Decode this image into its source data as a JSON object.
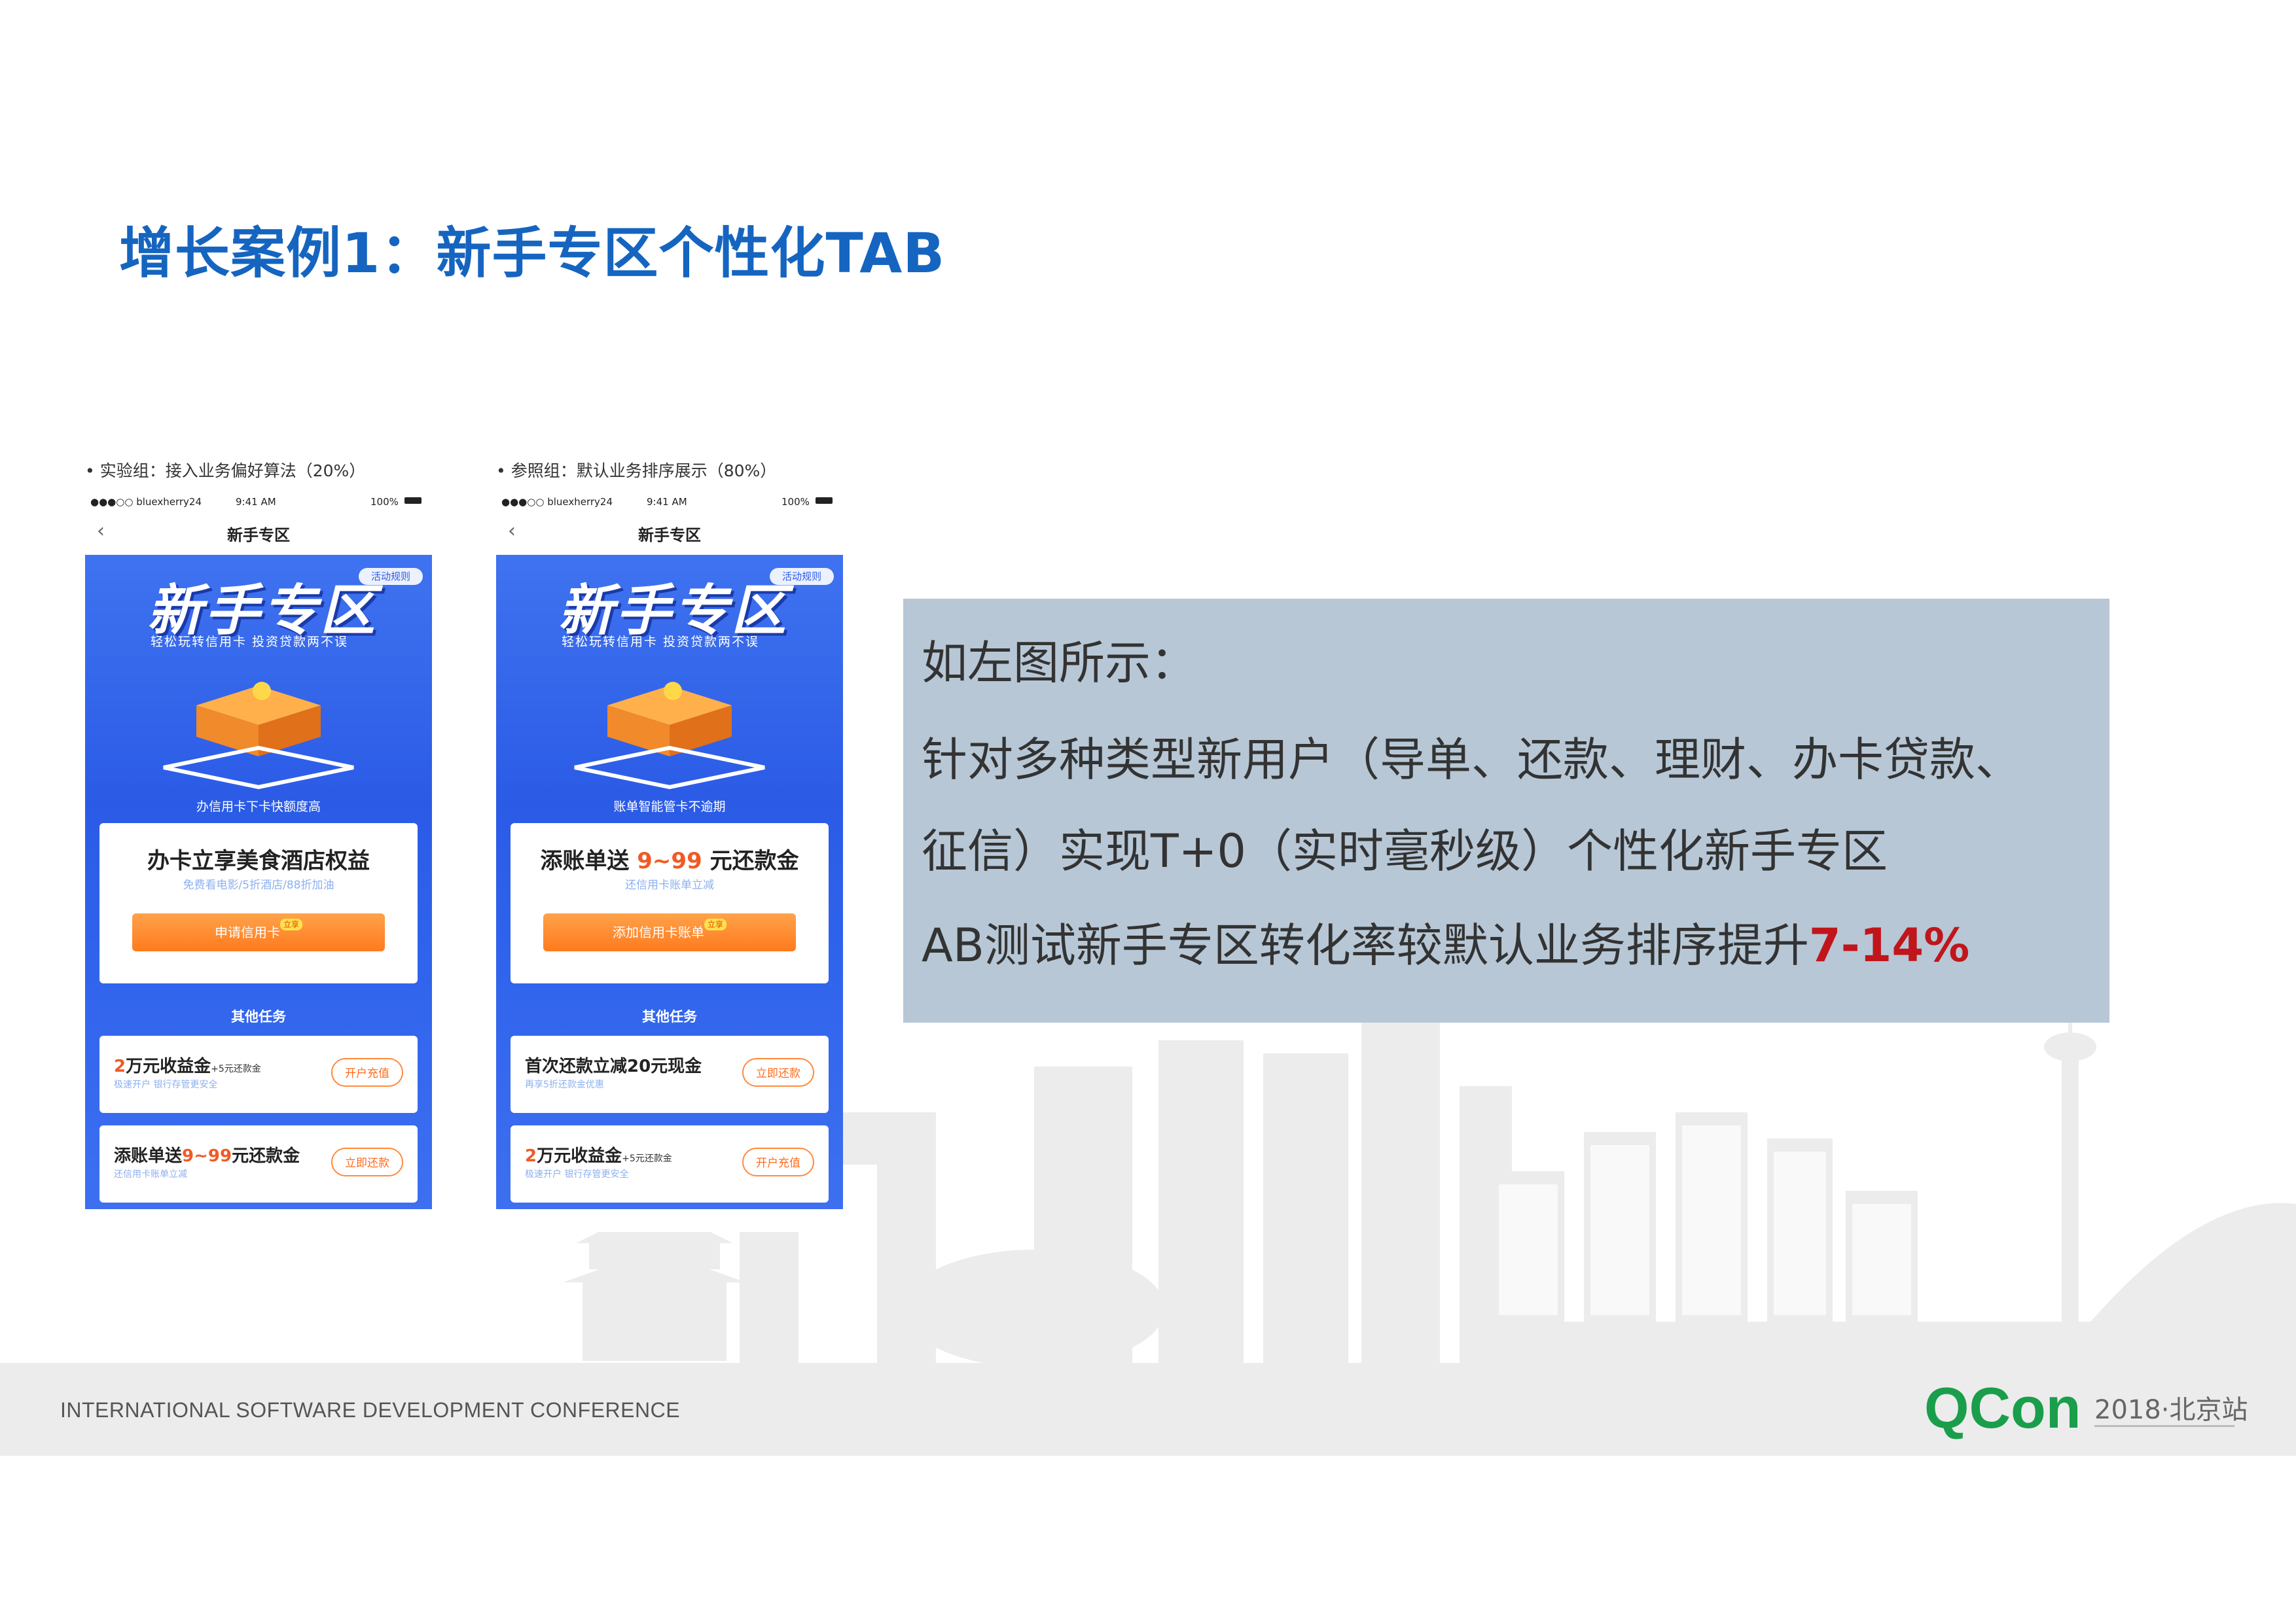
{
  "slide": {
    "title": "增长案例1：新手专区个性化TAB"
  },
  "phones": [
    {
      "caption": "• 实验组：接入业务偏好算法（20%）",
      "status": {
        "carrier": "●●●○○ bluexherry24",
        "time": "9:41 AM",
        "battery": "100%"
      },
      "nav_title": "新手专区",
      "hero": {
        "title": "新手专区",
        "rules": "活动规则",
        "subtitle": "轻松玩转信用卡  投资贷款两不误",
        "tagline": "办信用卡下卡快额度高"
      },
      "main_card": {
        "title_prefix": "办卡立享美食酒店权益",
        "title_highlight": "",
        "title_suffix": "",
        "subtitle": "免费看电影/5折酒店/88折加油",
        "button": "申请信用卡",
        "button_tag": "立享"
      },
      "other_tasks": "其他任务",
      "tasks": [
        {
          "title_red": "2",
          "title_main": "万元收益金",
          "title_extra": "+5元还款金",
          "subtitle": "极速开户  银行存管更安全",
          "button": "开户充值"
        },
        {
          "title_red": "",
          "title_main": "添账单送",
          "title_hl": "9~99",
          "title_end": "元还款金",
          "subtitle": "还信用卡账单立减",
          "button": "立即还款"
        }
      ]
    },
    {
      "caption": "• 参照组：默认业务排序展示（80%）",
      "status": {
        "carrier": "●●●○○ bluexherry24",
        "time": "9:41 AM",
        "battery": "100%"
      },
      "nav_title": "新手专区",
      "hero": {
        "title": "新手专区",
        "rules": "活动规则",
        "subtitle": "轻松玩转信用卡  投资贷款两不误",
        "tagline": "账单智能管卡不逾期"
      },
      "main_card": {
        "title_prefix": "添账单送 ",
        "title_highlight": "9~99",
        "title_suffix": " 元还款金",
        "subtitle": "还信用卡账单立减",
        "button": "添加信用卡账单",
        "button_tag": "立享"
      },
      "other_tasks": "其他任务",
      "tasks": [
        {
          "title_red": "",
          "title_main": "首次还款立减20元现金",
          "title_extra": "",
          "subtitle": "再享5折还款金优惠",
          "button": "立即还款"
        },
        {
          "title_red": "2",
          "title_main": "万元收益金",
          "title_extra": "+5元还款金",
          "subtitle": "极速开户  银行存管更安全",
          "button": "开户充值"
        }
      ]
    }
  ],
  "info": {
    "line1": "如左图所示：",
    "line2": "针对多种类型新用户（导单、还款、理财、办卡贷款、",
    "line3": "征信）实现T+0（实时毫秒级）个性化新手专区",
    "line4_prefix": "AB测试新手专区转化率较默认业务排序提升",
    "line4_highlight": "7-14%"
  },
  "footer": {
    "conference": "INTERNATIONAL SOFTWARE DEVELOPMENT CONFERENCE",
    "brand": "QCon",
    "edition": "2018·北京站"
  },
  "colors": {
    "title": "#1565c0",
    "highlight": "#c0161b",
    "infobox": "#b7c7d6",
    "brand_green": "#1a9e4b",
    "brand_blue": "#1e4fa0"
  }
}
